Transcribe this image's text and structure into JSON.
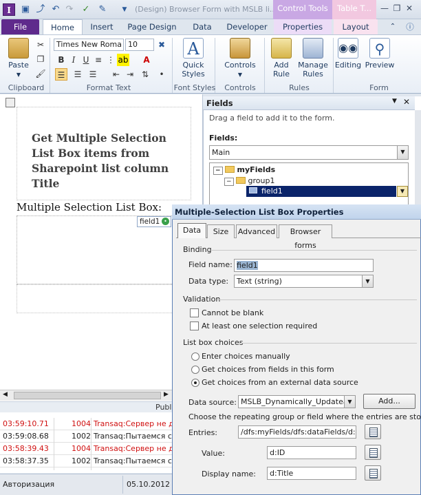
{
  "titlebar": {
    "app_icon": "I",
    "title": "(Design) Browser Form with MSLB li...",
    "contextual_control": "Control Tools",
    "contextual_table": "Table T..."
  },
  "tabs": [
    "File",
    "Home",
    "Insert",
    "Page Design",
    "Data",
    "Developer",
    "Properties",
    "Layout"
  ],
  "ribbon": {
    "paste": "Paste",
    "font_name": "Times New Roma",
    "font_size": "10",
    "quick_styles": "Quick Styles",
    "controls": "Controls",
    "add_rule": "Add Rule",
    "manage_rules": "Manage Rules",
    "editing": "Editing",
    "preview": "Preview",
    "groups": [
      "Clipboard",
      "Format Text",
      "Font Styles",
      "Controls",
      "Rules",
      "Form"
    ]
  },
  "canvas": {
    "title": "Get Multiple Selection List Box items from Sharepoint list column Title",
    "list_label": "Multiple Selection List Box:",
    "field_tag": "field1",
    "pub_label": "Publ"
  },
  "fields_pane": {
    "header": "Fields",
    "instruction": "Drag a field to add it to the form.",
    "fields_label": "Fields:",
    "datasource": "Main",
    "tree": [
      "myFields",
      "group1",
      "field1"
    ]
  },
  "log": {
    "rows": [
      {
        "time": "03:59:10.71",
        "code": "1004",
        "msg": "Transaq:Сервер не д",
        "error": true
      },
      {
        "time": "03:59:08.68",
        "code": "1002",
        "msg": "Transaq:Пытаемся ст",
        "error": false
      },
      {
        "time": "03:58:39.43",
        "code": "1004",
        "msg": "Transaq:Сервер не д",
        "error": true
      },
      {
        "time": "03:58:37.35",
        "code": "1002",
        "msg": "Transaq:Пытаемся ст",
        "error": false
      }
    ],
    "status_left": "Авторизация",
    "status_date": "05.10.2012"
  },
  "dialog": {
    "title": "Multiple-Selection List Box Properties",
    "tabs": [
      "Data",
      "Size",
      "Advanced",
      "Browser forms"
    ],
    "binding": "Binding",
    "field_name_label": "Field name:",
    "field_name": "field1",
    "data_type_label": "Data type:",
    "data_type": "Text (string)",
    "validation": "Validation",
    "cannot_be_blank": "Cannot be blank",
    "at_least_one": "At least one selection required",
    "choices": "List box choices",
    "opt_manual": "Enter choices manually",
    "opt_fields": "Get choices from fields in this form",
    "opt_external": "Get choices from an external data source",
    "data_source_label": "Data source:",
    "data_source": "MSLB_Dynamically_Updateable",
    "add_button": "Add...",
    "instruction": "Choose the repeating group or field where the entries are stored.",
    "entries_label": "Entries:",
    "entries": "/dfs:myFields/dfs:dataFields/d:Sha",
    "value_label": "Value:",
    "value": "d:ID",
    "display_name_label": "Display name:",
    "display_name": "d:Title"
  }
}
